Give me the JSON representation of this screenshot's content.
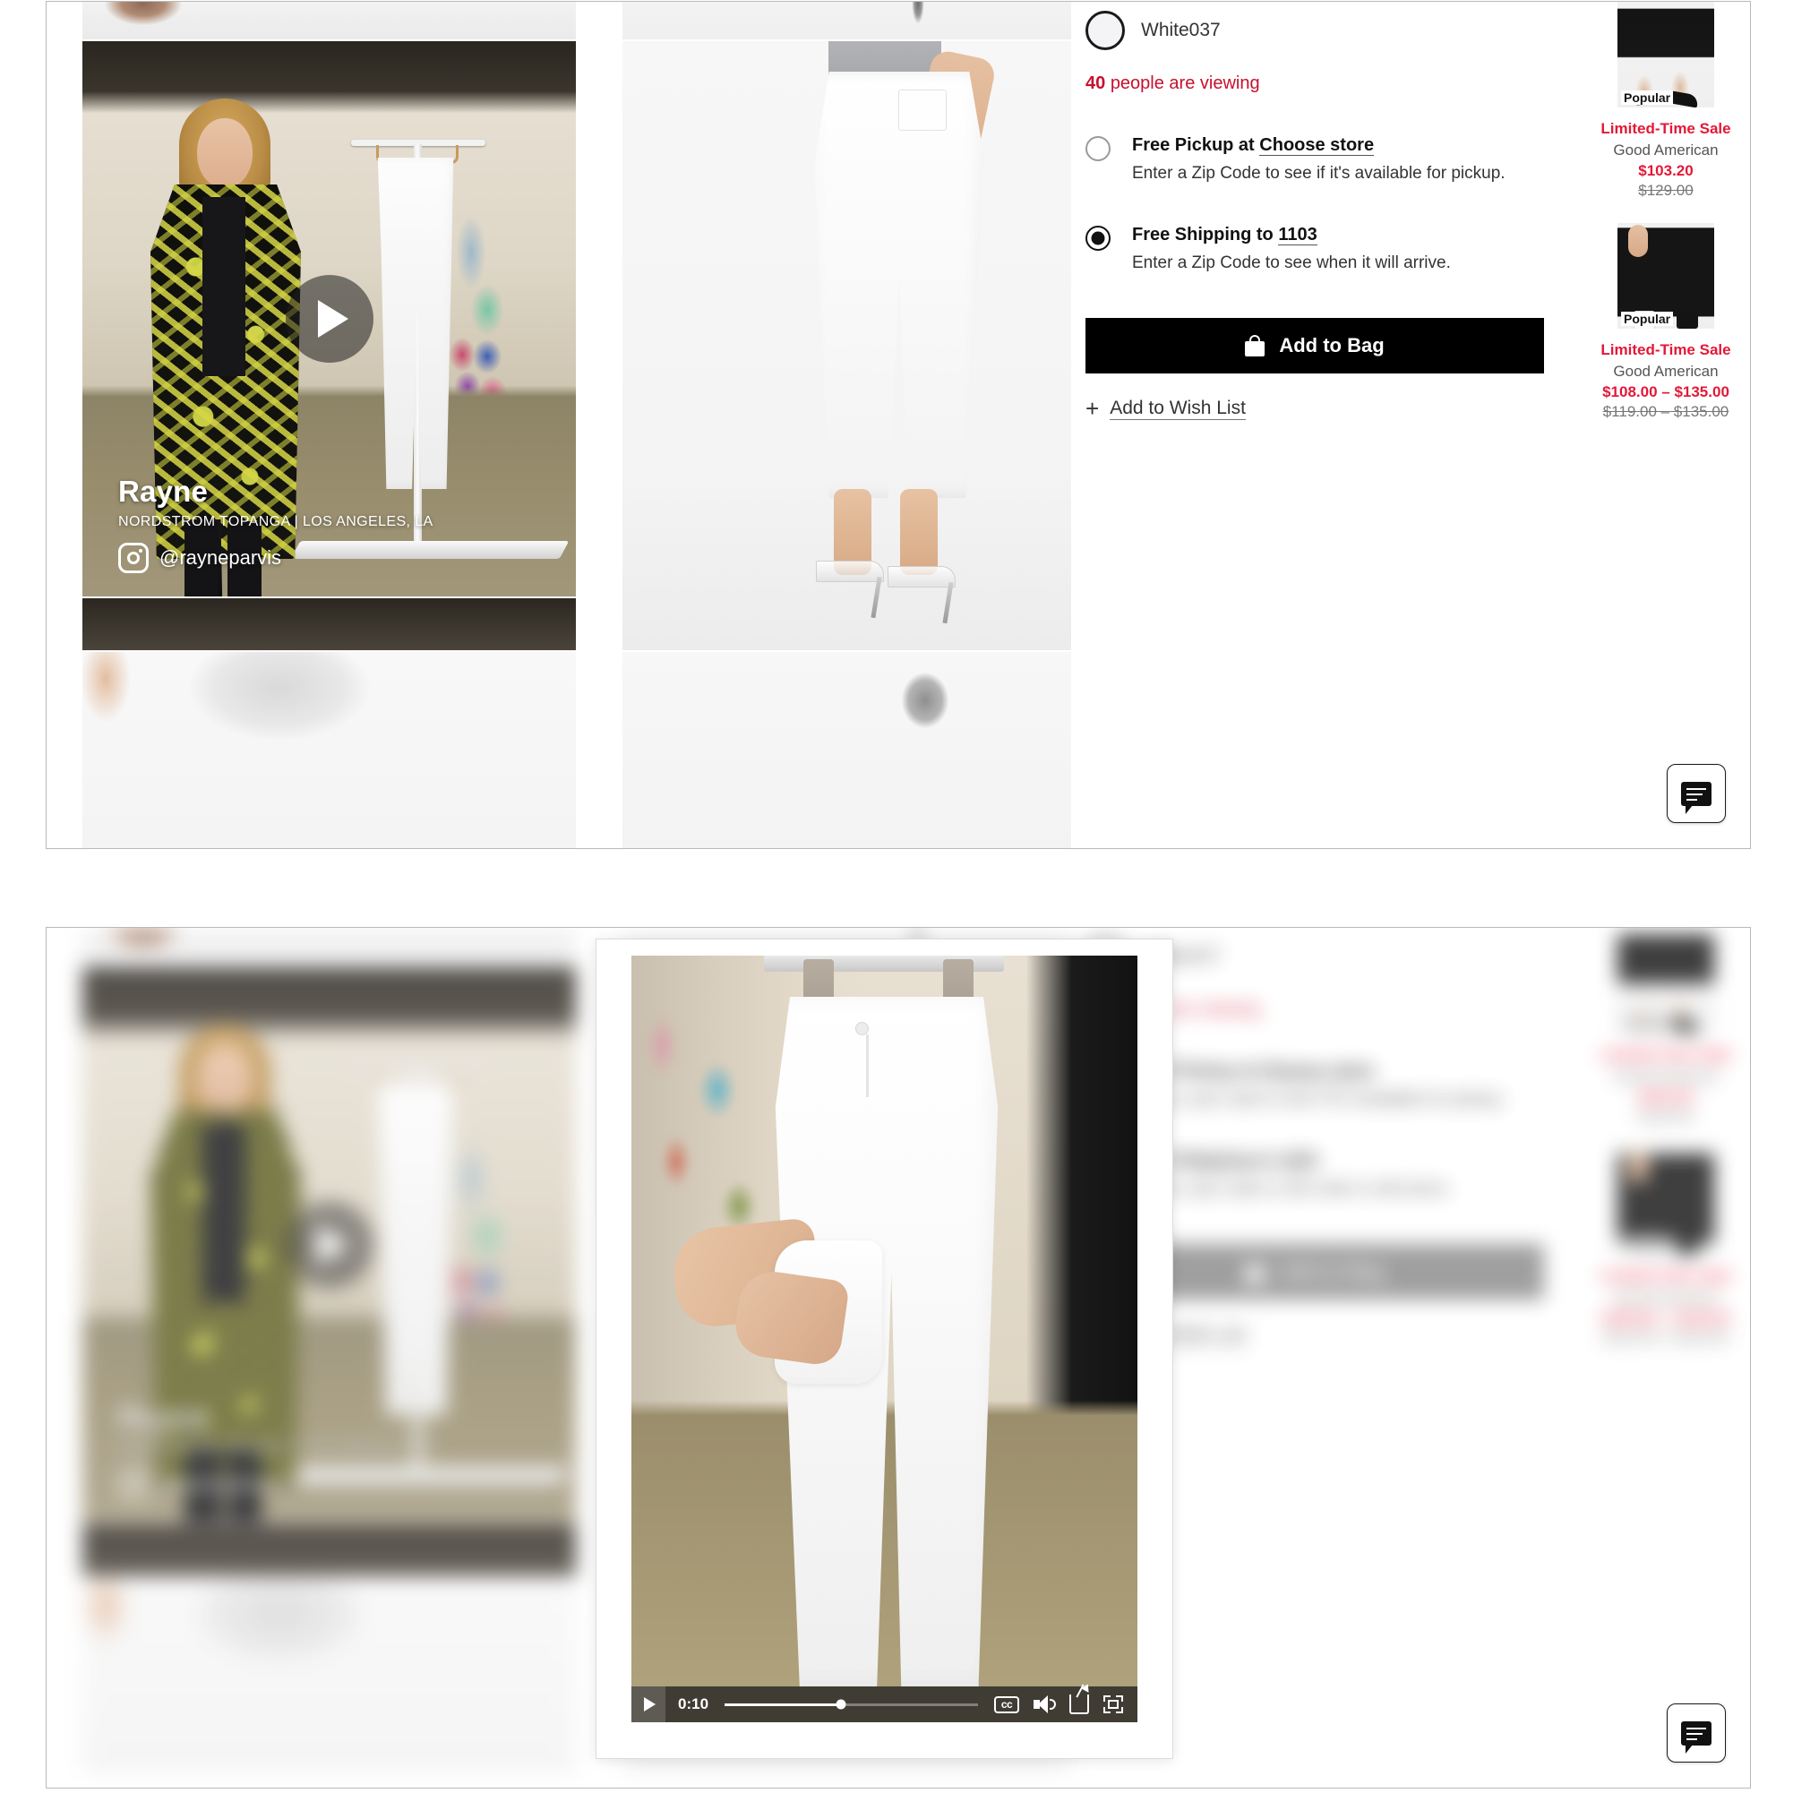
{
  "product": {
    "swatch_label": "White037",
    "viewing_count": "40",
    "viewing_text": "people are viewing"
  },
  "fulfillment": {
    "pickup": {
      "title_prefix": "Free Pickup at ",
      "title_link": "Choose store",
      "subtitle": "Enter a Zip Code to see if it's available for pickup.",
      "selected": false
    },
    "shipping": {
      "title_prefix": "Free Shipping to ",
      "title_link": "1103",
      "subtitle": "Enter a Zip Code to see when it will arrive.",
      "selected": true
    }
  },
  "actions": {
    "add_to_bag": "Add to Bag",
    "add_to_wish_list": "Add to Wish List",
    "plus_glyph": "+"
  },
  "video_overlay": {
    "name": "Rayne",
    "store": "NORDSTROM TOPANGA | LOS ANGELES, LA",
    "handle": "@rayneparvis"
  },
  "video_player": {
    "time": "0:10",
    "cc_label": "cc",
    "progress_percent": 46
  },
  "recommendations": [
    {
      "badge": "Popular",
      "sale_label": "Limited-Time Sale",
      "brand": "Good American",
      "price": "$103.20",
      "was": "$129.00"
    },
    {
      "badge": "Popular",
      "sale_label": "Limited-Time Sale",
      "brand": "Good American",
      "price": "$108.00 – $135.00",
      "was": "$119.00 – $135.00"
    }
  ],
  "colors": {
    "sale_red": "#e31837",
    "viewing_red": "#c8102e",
    "primary_black": "#000000"
  }
}
